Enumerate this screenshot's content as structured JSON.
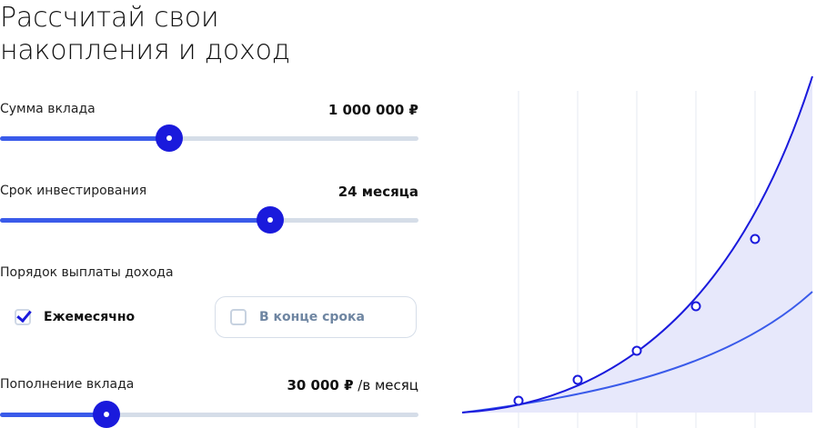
{
  "title": {
    "line1": "Рассчитай свои",
    "line2": "накопления и доход"
  },
  "deposit_amount": {
    "label": "Сумма вклада",
    "value": "1 000 000 ₽",
    "slider_fraction": 0.405
  },
  "investment_term": {
    "label": "Срок инвестирования",
    "value": "24 месяца",
    "slider_fraction": 0.645
  },
  "payout_order": {
    "label": "Порядок выплаты дохода",
    "options": [
      {
        "label": "Ежемесячно",
        "checked": true
      },
      {
        "label": "В конце срока",
        "checked": false
      }
    ]
  },
  "top_up": {
    "label": "Пополнение вклада",
    "value": "30 000 ₽",
    "suffix": " /в месяц",
    "slider_fraction": 0.255
  },
  "colors": {
    "accent": "#1a1adc",
    "slider_fill": "#3a5bea",
    "track": "#d5dde8",
    "area_fill": "#e7e8fb",
    "inner_line": "#3a5bea",
    "muted_text": "#6f86a2"
  },
  "icons": {
    "checkbox_checked": "check-icon",
    "checkbox_unchecked": "empty-checkbox-icon"
  }
}
